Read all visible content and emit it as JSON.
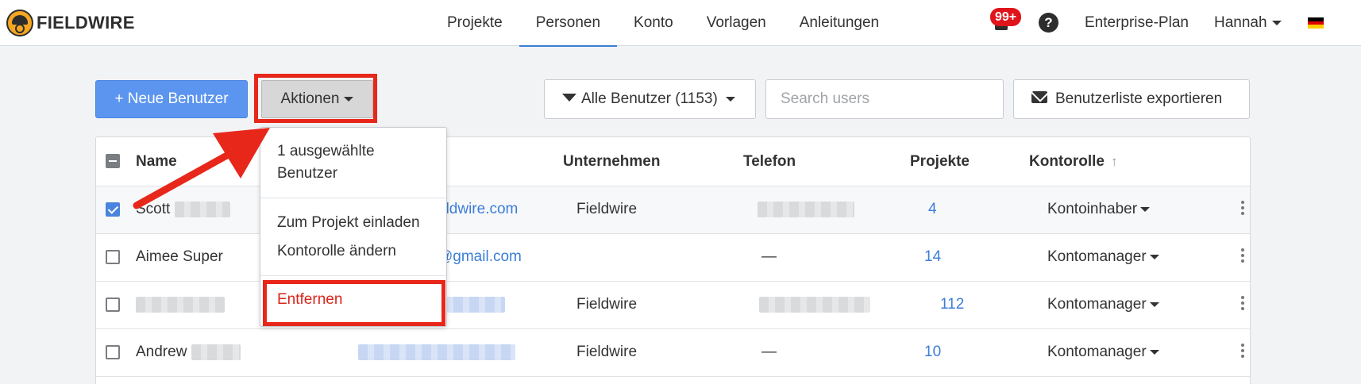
{
  "brand": {
    "name": "FIELDWIRE"
  },
  "nav": {
    "items": [
      {
        "label": "Projekte"
      },
      {
        "label": "Personen",
        "active": true
      },
      {
        "label": "Konto"
      },
      {
        "label": "Vorlagen"
      },
      {
        "label": "Anleitungen"
      }
    ]
  },
  "header_right": {
    "notifications_badge": "99+",
    "help_icon": "question-mark-circle-icon",
    "plan_label": "Enterprise-Plan",
    "user_name": "Hannah",
    "language_flag": "germany-flag-icon"
  },
  "toolbar": {
    "new_user_label": "+ Neue Benutzer",
    "actions_label": "Aktionen",
    "filter_label": "Alle Benutzer (1153)",
    "search_placeholder": "Search users",
    "export_label": "Benutzerliste exportieren"
  },
  "table": {
    "columns": {
      "name": "Name",
      "company": "Unternehmen",
      "phone": "Telefon",
      "projects": "Projekte",
      "role": "Kontorolle"
    },
    "rows": [
      {
        "checked": true,
        "name": "Scott",
        "email": "eldwire.com",
        "company": "Fieldwire",
        "phone": "",
        "projects": "4",
        "role": "Kontoinhaber"
      },
      {
        "checked": false,
        "name": "Aimee Super",
        "email": "@gmail.com",
        "company": "",
        "phone": "—",
        "projects": "14",
        "role": "Kontomanager"
      },
      {
        "checked": false,
        "name": "",
        "email": "",
        "company": "Fieldwire",
        "phone": "",
        "projects": "112",
        "role": "Kontomanager"
      },
      {
        "checked": false,
        "name": "Andrew",
        "email": "",
        "company": "Fieldwire",
        "phone": "—",
        "projects": "10",
        "role": "Kontomanager"
      }
    ]
  },
  "actions_menu": {
    "header": "1 ausgewählte Benutzer",
    "invite_label": "Zum Projekt einladen",
    "change_role_label": "Kontorolle ändern",
    "remove_label": "Entfernen"
  },
  "colors": {
    "primary": "#5b95ef",
    "link": "#3b7dd8",
    "highlight": "#e8271b",
    "danger": "#d9251c"
  }
}
